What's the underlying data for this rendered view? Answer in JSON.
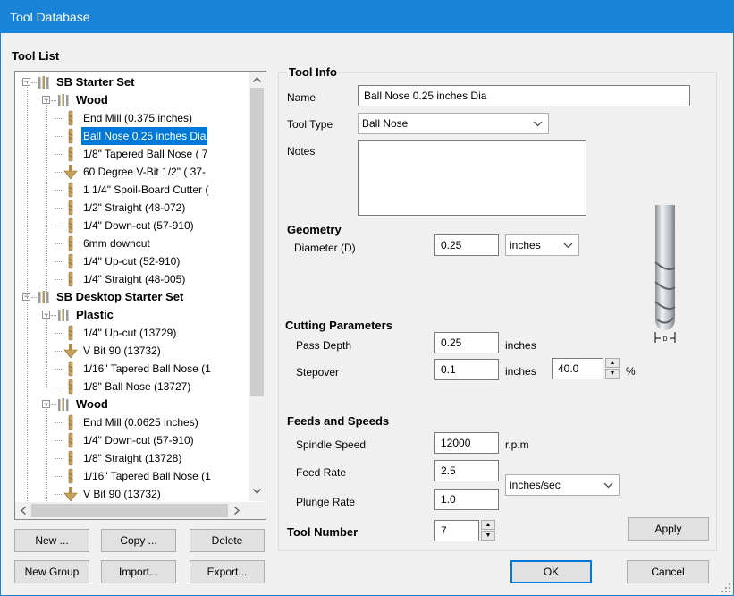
{
  "window": {
    "title": "Tool Database"
  },
  "tool_list": {
    "heading": "Tool List",
    "rows": [
      {
        "label": "SB Starter Set",
        "kind": "set"
      },
      {
        "label": "Wood",
        "kind": "group"
      },
      {
        "label": "End Mill (0.375 inches)",
        "kind": "tool"
      },
      {
        "label": "Ball Nose 0.25 inches Dia",
        "kind": "tool",
        "selected": true
      },
      {
        "label": "1/8\" Tapered Ball Nose ( 7",
        "kind": "tool"
      },
      {
        "label": "60 Degree V-Bit 1/2\"  ( 37-",
        "kind": "tool"
      },
      {
        "label": "1 1/4\" Spoil-Board Cutter (",
        "kind": "tool"
      },
      {
        "label": "1/2\" Straight  (48-072)",
        "kind": "tool"
      },
      {
        "label": "1/4\"  Down-cut (57-910)",
        "kind": "tool"
      },
      {
        "label": "6mm downcut",
        "kind": "tool"
      },
      {
        "label": "1/4\" Up-cut (52-910)",
        "kind": "tool"
      },
      {
        "label": "1/4\" Straight  (48-005)",
        "kind": "tool"
      },
      {
        "label": "SB Desktop Starter Set",
        "kind": "set"
      },
      {
        "label": "Plastic",
        "kind": "group"
      },
      {
        "label": "1/4\" Up-cut (13729)",
        "kind": "tool"
      },
      {
        "label": "V Bit 90 (13732)",
        "kind": "tool"
      },
      {
        "label": "1/16\" Tapered Ball Nose (1",
        "kind": "tool"
      },
      {
        "label": "1/8\" Ball Nose (13727)",
        "kind": "tool"
      },
      {
        "label": "Wood",
        "kind": "group"
      },
      {
        "label": "End Mill (0.0625 inches)",
        "kind": "tool"
      },
      {
        "label": "1/4\"  Down-cut (57-910)",
        "kind": "tool"
      },
      {
        "label": "1/8\" Straight (13728)",
        "kind": "tool"
      },
      {
        "label": "1/16\" Tapered Ball Nose (1",
        "kind": "tool"
      },
      {
        "label": "V Bit 90 (13732)",
        "kind": "tool"
      }
    ],
    "buttons": {
      "new": "New ...",
      "copy": "Copy ...",
      "delete": "Delete",
      "new_group": "New Group",
      "import": "Import...",
      "export": "Export..."
    }
  },
  "tool_info": {
    "heading": "Tool Info",
    "name_label": "Name",
    "name_value": "Ball Nose 0.25 inches Dia",
    "type_label": "Tool Type",
    "type_value": "Ball Nose",
    "notes_label": "Notes",
    "notes_value": ""
  },
  "geometry": {
    "heading": "Geometry",
    "diameter_label": "Diameter (D)",
    "diameter_value": "0.25",
    "diameter_unit": "inches",
    "diagram_label": "D"
  },
  "cutting": {
    "heading": "Cutting Parameters",
    "pass_depth_label": "Pass Depth",
    "pass_depth_value": "0.25",
    "pass_depth_unit": "inches",
    "stepover_label": "Stepover",
    "stepover_value": "0.1",
    "stepover_unit": "inches",
    "stepover_percent": "40.0",
    "percent_sign": "%"
  },
  "feeds": {
    "heading": "Feeds and Speeds",
    "spindle_label": "Spindle Speed",
    "spindle_value": "12000",
    "spindle_unit": "r.p.m",
    "feed_label": "Feed Rate",
    "feed_value": "2.5",
    "plunge_label": "Plunge Rate",
    "plunge_value": "1.0",
    "rate_unit": "inches/sec"
  },
  "tool_number": {
    "label": "Tool Number",
    "value": "7"
  },
  "actions": {
    "apply": "Apply",
    "ok": "OK",
    "cancel": "Cancel"
  },
  "colors": {
    "titlebar": "#1883d7",
    "selection": "#0078d7",
    "bit_gold": "#c8a25a"
  }
}
